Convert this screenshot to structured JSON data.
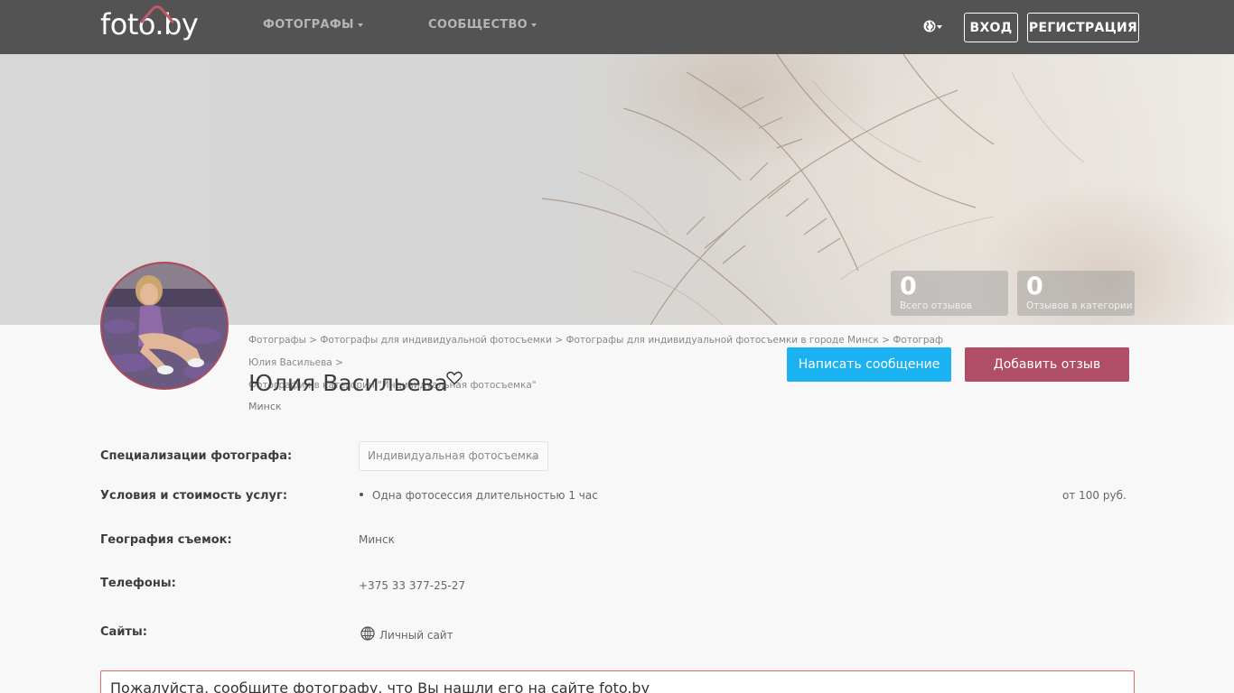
{
  "header": {
    "logo": "foto.by",
    "nav": [
      {
        "label": "ФОТОГРАФЫ"
      },
      {
        "label": "СООБЩЕСТВО"
      }
    ],
    "language_icon": "globe-icon",
    "login_label": "ВХОД",
    "register_label": "РЕГИСТРАЦИЯ"
  },
  "stats": [
    {
      "value": "0",
      "label": "Всего отзывов"
    },
    {
      "value": "0",
      "label": "Отзывов в категории"
    }
  ],
  "breadcrumb": {
    "items": [
      "Фотографы",
      "Фотографы для индивидуальной фотосъемки",
      "Фотографы для индивидуальной фотосъемки в городе Минск",
      "Фотограф Юлия Васильева",
      "Фотографии в категории \"Индивидуальная фотосъемка\""
    ],
    "separator": ">"
  },
  "profile": {
    "name": "Юлия Васильева",
    "city": "Минск",
    "favorite_icon": "heart-outline-icon",
    "message_button": "Написать сообщение",
    "review_button": "Добавить отзыв"
  },
  "info": {
    "specializations_label": "Специализации фотографа:",
    "specialization_selected": "Индивидуальная фотосъемка",
    "services_label": "Условия и стоимость услуг:",
    "service_item": "Одна фотосессия длительностью 1 час",
    "service_price": "от 100 руб.",
    "geography_label": "География съемок:",
    "geography_value": "Минск",
    "phones_label": "Телефоны:",
    "phone_value": "+375 33 377-25-27",
    "sites_label": "Сайты:",
    "site_value": "Личный сайт"
  },
  "notice": {
    "text": "Пожалуйста, сообщите фотографу, что Вы нашли его на сайте foto.by"
  },
  "colors": {
    "header_bg": "#535353",
    "message_button": "#1ab2f0",
    "review_button": "#b04d67",
    "notice_border": "#d96c6c"
  }
}
